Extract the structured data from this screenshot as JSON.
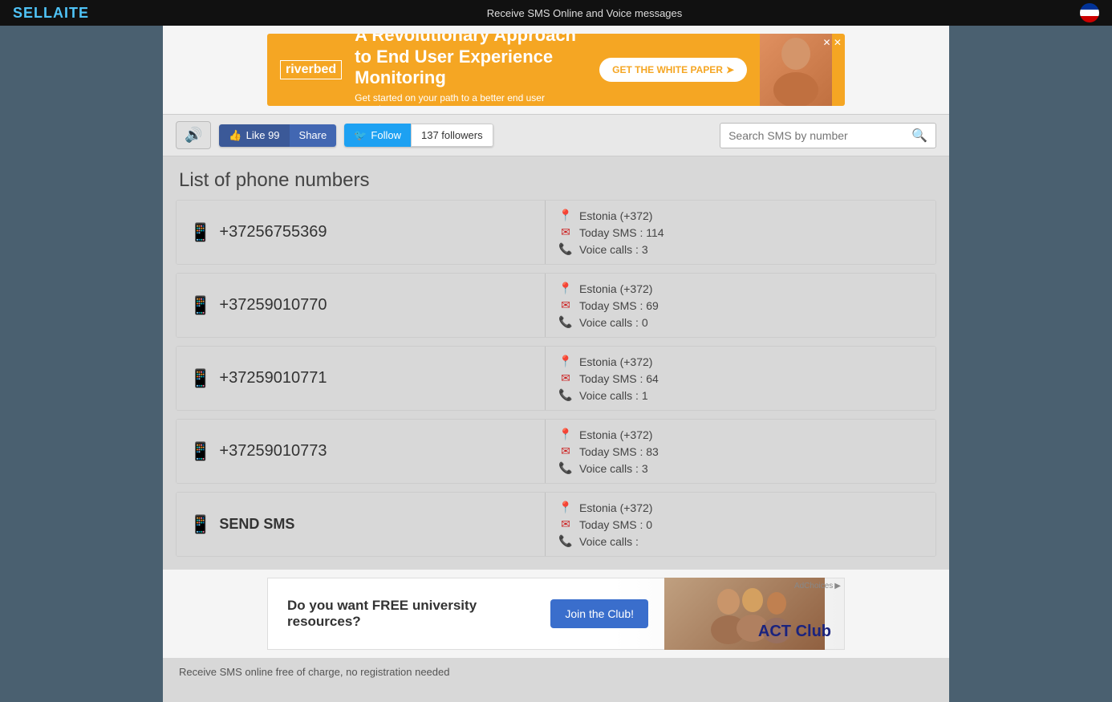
{
  "topbar": {
    "logo_part1": "SELL",
    "logo_part2": "A",
    "logo_part3": "ITE",
    "message": "Receive SMS Online and Voice messages"
  },
  "ad_top": {
    "brand": "riverbed",
    "headline": "A Revolutionary Approach to End User Experience Monitoring",
    "subtext": "Get started on your path to a better end user experience",
    "cta": "GET THE WHITE PAPER"
  },
  "toolbar": {
    "sound_icon": "🔊",
    "fb_like_label": "Like 99",
    "fb_share_label": "Share",
    "tw_follow_label": "Follow",
    "tw_followers_label": "137 followers",
    "search_placeholder": "Search SMS by number"
  },
  "page_title": "List of phone numbers",
  "phone_numbers": [
    {
      "number": "+37256755369",
      "country": "Estonia (+372)",
      "sms": "Today SMS : 114",
      "voice": "Voice calls : 3"
    },
    {
      "number": "+37259010770",
      "country": "Estonia (+372)",
      "sms": "Today SMS : 69",
      "voice": "Voice calls : 0"
    },
    {
      "number": "+37259010771",
      "country": "Estonia (+372)",
      "sms": "Today SMS : 64",
      "voice": "Voice calls : 1"
    },
    {
      "number": "+37259010773",
      "country": "Estonia (+372)",
      "sms": "Today SMS : 83",
      "voice": "Voice calls : 3"
    }
  ],
  "send_sms": {
    "label": "SEND SMS",
    "country": "Estonia (+372)",
    "sms": "Today SMS : 0",
    "voice": "Voice calls :"
  },
  "ad_bottom": {
    "headline": "Do you want FREE university resources?",
    "cta": "Join the Club!",
    "brand": "ACT Club",
    "ad_choices": "AdChoices"
  },
  "bottom_text": "Receive SMS online free of charge, no registration needed"
}
